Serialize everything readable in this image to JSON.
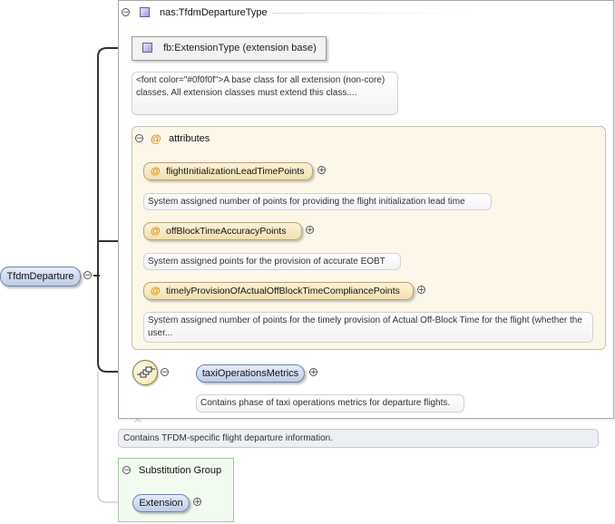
{
  "root_element": {
    "name": "TfdmDeparture",
    "toggle": "−"
  },
  "type": {
    "name": "nas:TfdmDepartureType",
    "toggle": "−",
    "icon": "complex-type-icon",
    "extension": {
      "label": "fb:ExtensionType (extension base)",
      "icon": "complex-type-icon",
      "doc": "<font color=\"#0f0f0f\">A base class for all extension (non-core) classes. All extension classes must extend this class...."
    },
    "attributes": {
      "title": "attributes",
      "toggle": "−",
      "icon": "at-sign-icon",
      "items": [
        {
          "name": "flightInitializationLeadTimePoints",
          "doc": "System assigned number of points for providing the flight initialization lead time",
          "expand": "+"
        },
        {
          "name": "offBlockTimeAccuracyPoints",
          "doc": "System assigned points for the provision of accurate EOBT",
          "expand": "+"
        },
        {
          "name": "timelyProvisionOfActualOffBlockTimeCompliancePoints",
          "doc": "System assigned number of points for the timely provision of Actual Off-Block Time for the flight (whether the user...",
          "expand": "+"
        }
      ]
    },
    "sequence": {
      "icon": "sequence-compositor-icon",
      "toggle": "−",
      "element": {
        "name": "taxiOperationsMetrics",
        "doc": "Contains phase of taxi operations metrics for departure flights.",
        "expand": "+"
      }
    }
  },
  "element_doc": "Contains TFDM-specific flight departure information.",
  "substitution_group": {
    "title": "Substitution Group",
    "toggle": "−",
    "element": {
      "name": "Extension",
      "expand": "+"
    }
  },
  "colors": {
    "element_pill": "#bccde8",
    "attribute_pill": "#f0dfb0",
    "attribute_panel": "#fdf7ea",
    "substitution_panel": "#f1fbef",
    "connector": "#333333",
    "at_sign": "#e08a00"
  }
}
